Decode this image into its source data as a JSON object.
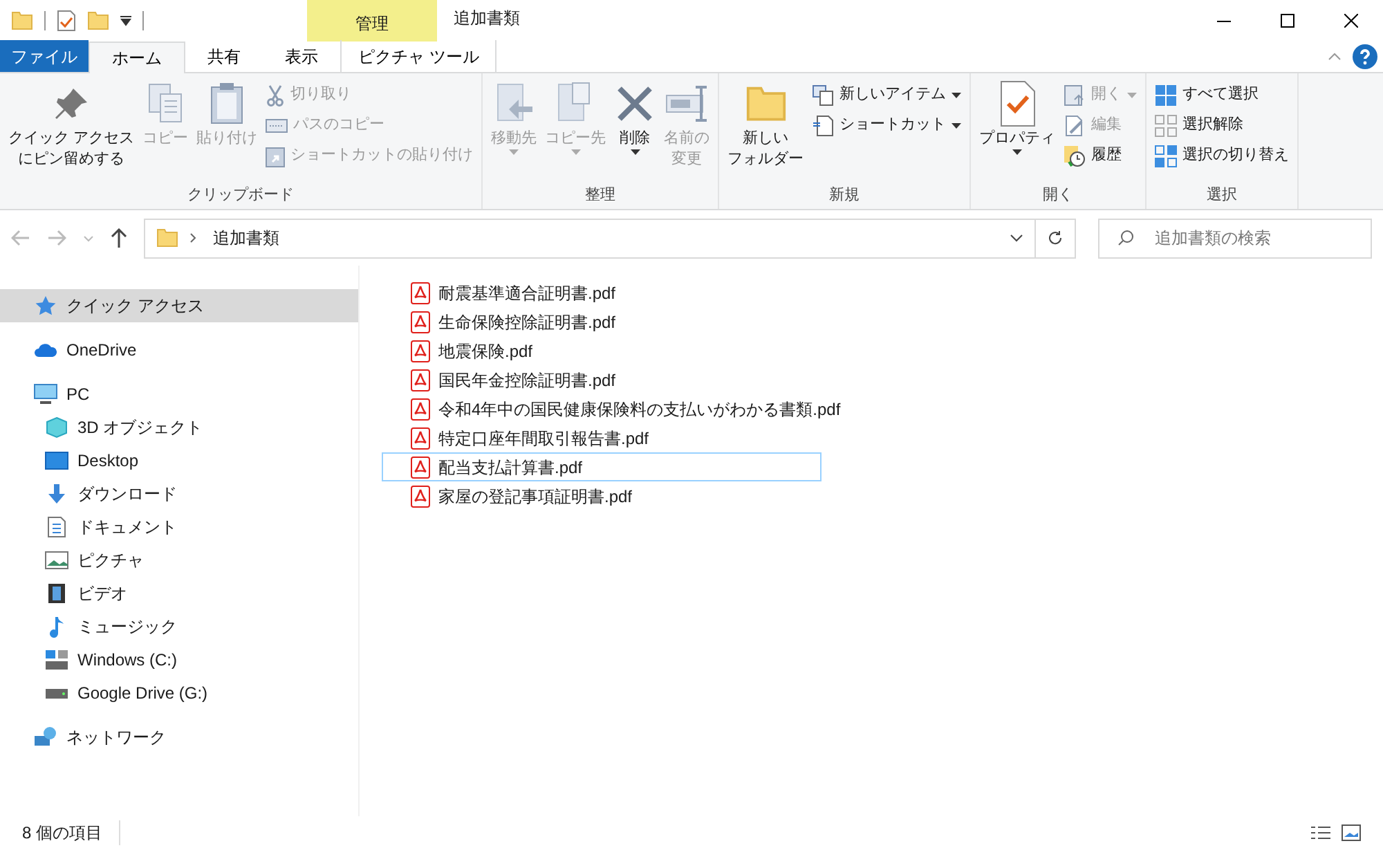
{
  "title_bar": {
    "context_label": "管理",
    "title": "追加書類"
  },
  "ribbon_tabs": [
    {
      "label": "ファイル",
      "kind": "file",
      "selected": false
    },
    {
      "label": "ホーム",
      "kind": "normal",
      "selected": true
    },
    {
      "label": "共有",
      "kind": "normal",
      "selected": false
    },
    {
      "label": "表示",
      "kind": "normal",
      "selected": false
    },
    {
      "label": "ピクチャ ツール",
      "kind": "context",
      "selected": false
    }
  ],
  "ribbon_groups": [
    {
      "label": "クリップボード",
      "items": [
        {
          "kind": "large",
          "label_lines": [
            "クイック アクセス",
            "にピン留めする"
          ],
          "disabled": false
        },
        {
          "kind": "large",
          "label_lines": [
            "コピー"
          ],
          "disabled": true
        },
        {
          "kind": "large",
          "label_lines": [
            "貼り付け"
          ],
          "disabled": true
        },
        {
          "kind": "stack",
          "items": [
            {
              "label": "切り取り",
              "disabled": true
            },
            {
              "label": "パスのコピー",
              "disabled": true
            },
            {
              "label": "ショートカットの貼り付け",
              "disabled": true
            }
          ]
        }
      ]
    },
    {
      "label": "整理",
      "items": [
        {
          "kind": "large",
          "label_lines": [
            "移動先"
          ],
          "disabled": true,
          "dropdown": true
        },
        {
          "kind": "large",
          "label_lines": [
            "コピー先"
          ],
          "disabled": true,
          "dropdown": true
        },
        {
          "kind": "large",
          "label_lines": [
            "削除"
          ],
          "disabled": false,
          "dropdown": true
        },
        {
          "kind": "large",
          "label_lines": [
            "名前の",
            "変更"
          ],
          "disabled": true
        }
      ]
    },
    {
      "label": "新規",
      "items": [
        {
          "kind": "large",
          "label_lines": [
            "新しい",
            "フォルダー"
          ],
          "disabled": false
        },
        {
          "kind": "stack",
          "items": [
            {
              "label": "新しいアイテム",
              "disabled": false,
              "dropdown": true
            },
            {
              "label": "ショートカット",
              "disabled": false,
              "dropdown": true
            }
          ]
        }
      ]
    },
    {
      "label": "開く",
      "items": [
        {
          "kind": "large",
          "label_lines": [
            "プロパティ"
          ],
          "disabled": false,
          "dropdown": true
        },
        {
          "kind": "stack",
          "items": [
            {
              "label": "開く",
              "disabled": true,
              "dropdown": true
            },
            {
              "label": "編集",
              "disabled": true
            },
            {
              "label": "履歴",
              "disabled": false
            }
          ]
        }
      ]
    },
    {
      "label": "選択",
      "items": [
        {
          "kind": "stack",
          "items": [
            {
              "label": "すべて選択",
              "disabled": false
            },
            {
              "label": "選択解除",
              "disabled": false
            },
            {
              "label": "選択の切り替え",
              "disabled": false
            }
          ]
        }
      ]
    }
  ],
  "address": {
    "path": "追加書類",
    "search_placeholder": "追加書類の検索"
  },
  "nav": [
    {
      "label": "クイック アクセス",
      "selected": true
    },
    {
      "label": "OneDrive",
      "selected": false
    },
    {
      "label": "PC",
      "selected": false,
      "children": [
        {
          "label": "3D オブジェクト",
          "selected": false
        },
        {
          "label": "Desktop",
          "selected": false
        },
        {
          "label": "ダウンロード",
          "selected": false
        },
        {
          "label": "ドキュメント",
          "selected": false
        },
        {
          "label": "ピクチャ",
          "selected": false
        },
        {
          "label": "ビデオ",
          "selected": false
        },
        {
          "label": "ミュージック",
          "selected": false
        },
        {
          "label": "Windows  (C:)",
          "selected": false
        },
        {
          "label": "Google Drive (G:)",
          "selected": false
        }
      ]
    },
    {
      "label": "ネットワーク",
      "selected": false
    }
  ],
  "files": [
    {
      "name": "耐震基準適合証明書.pdf",
      "focused": false
    },
    {
      "name": "生命保険控除証明書.pdf",
      "focused": false
    },
    {
      "name": "地震保険.pdf",
      "focused": false
    },
    {
      "name": "国民年金控除証明書.pdf",
      "focused": false
    },
    {
      "name": "令和4年中の国民健康保険料の支払いがわかる書類.pdf",
      "focused": false
    },
    {
      "name": "特定口座年間取引報告書.pdf",
      "focused": false
    },
    {
      "name": "配当支払計算書.pdf",
      "focused": true
    },
    {
      "name": "家屋の登記事項証明書.pdf",
      "focused": false
    }
  ],
  "status_bar": {
    "item_count": "8 個の項目"
  }
}
